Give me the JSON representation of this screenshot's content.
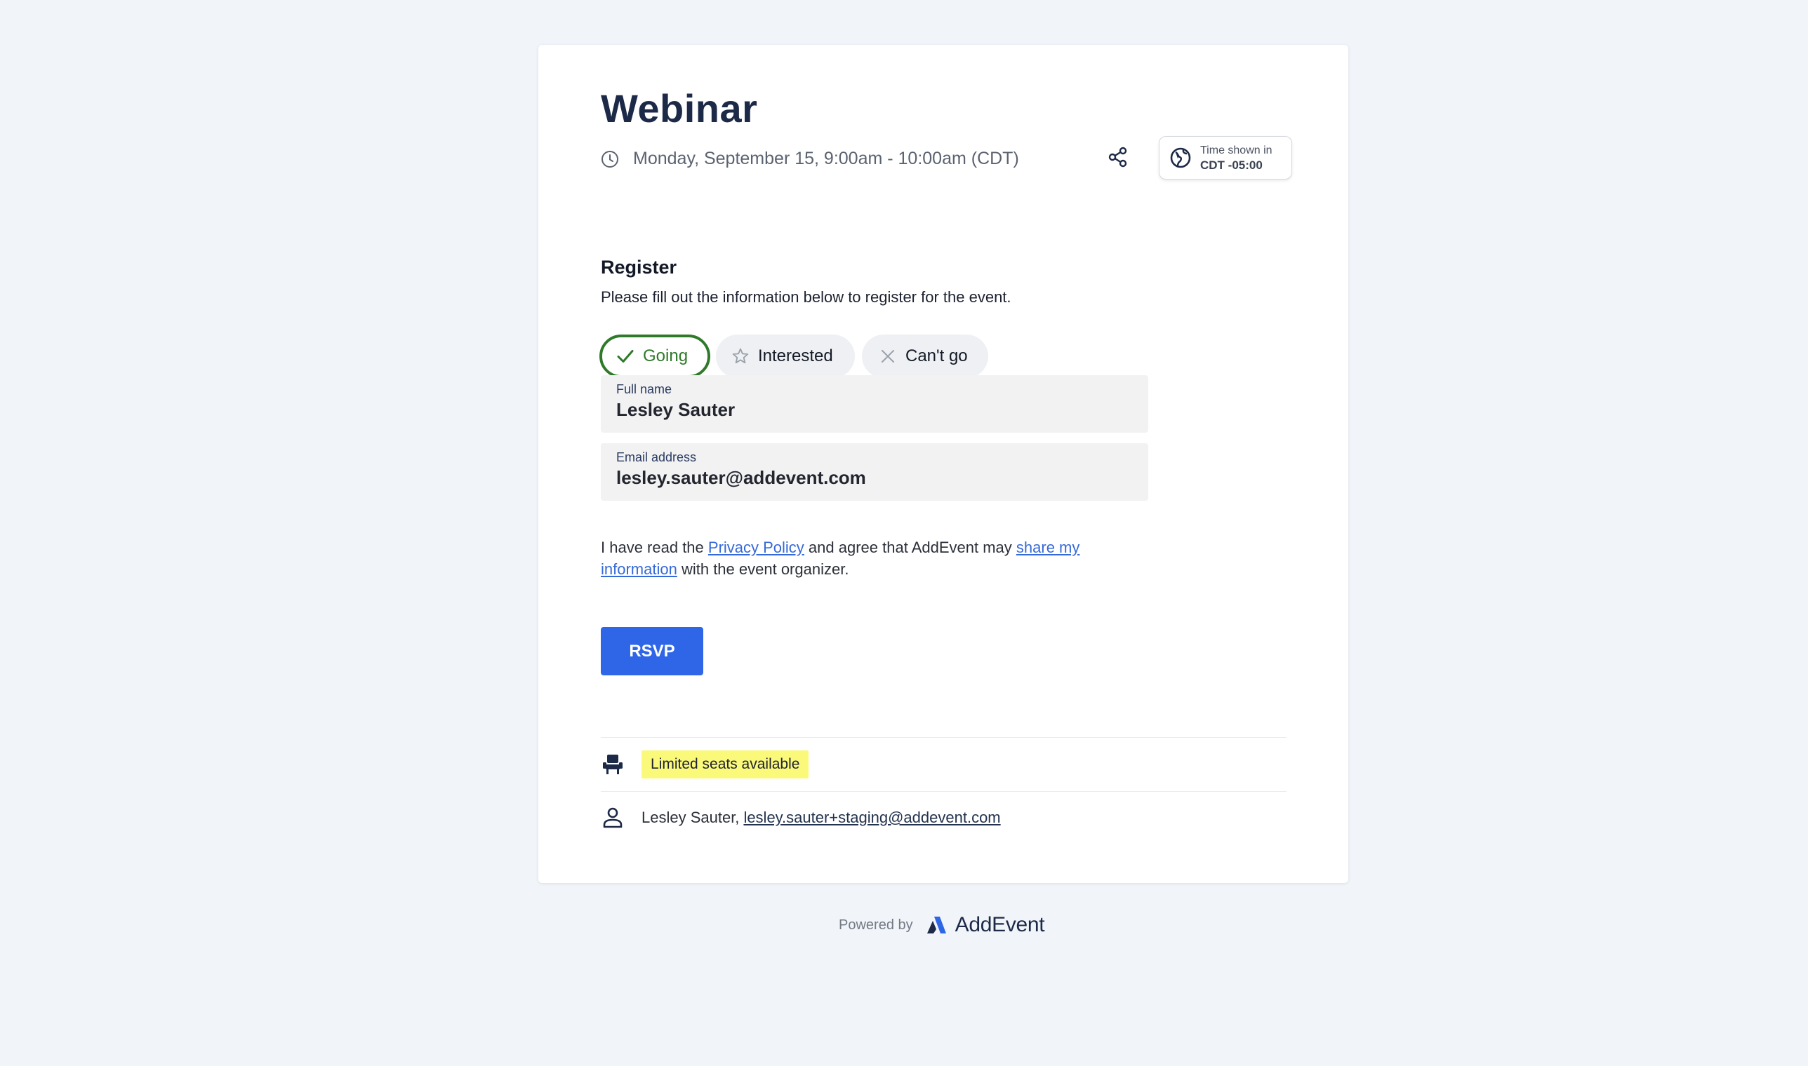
{
  "event": {
    "title": "Webinar",
    "datetime": "Monday, September 15, 9:00am - 10:00am (CDT)"
  },
  "timezone": {
    "label": "Time shown in",
    "value": "CDT -05:00"
  },
  "register": {
    "heading": "Register",
    "description": "Please fill out the information below to register for the event.",
    "options": [
      {
        "label": "Going",
        "icon": "check-icon",
        "selected": true
      },
      {
        "label": "Interested",
        "icon": "star-icon",
        "selected": false
      },
      {
        "label": "Can't go",
        "icon": "close-icon",
        "selected": false
      }
    ]
  },
  "form": {
    "full_name_label": "Full name",
    "full_name_value": "Lesley Sauter",
    "email_label": "Email address",
    "email_value": "lesley.sauter@addevent.com"
  },
  "consent": {
    "text_1": "I have read the ",
    "privacy_link": "Privacy Policy",
    "text_2": " and agree that AddEvent may ",
    "share_link": "share my information",
    "text_3": " with the event organizer."
  },
  "rsvp_button": "RSVP",
  "seats": {
    "badge": "Limited seats available",
    "icon": "chair-icon"
  },
  "organizer": {
    "name": "Lesley Sauter, ",
    "email": "lesley.sauter+staging@addevent.com",
    "icon": "person-icon"
  },
  "footer": {
    "powered_by": "Powered by",
    "brand": "AddEvent"
  },
  "colors": {
    "background": "#f1f4f8",
    "accent_blue": "#2f66e8",
    "going_green": "#2f7a2a",
    "badge_yellow": "#fbf97a",
    "title_navy": "#1c2a48"
  }
}
